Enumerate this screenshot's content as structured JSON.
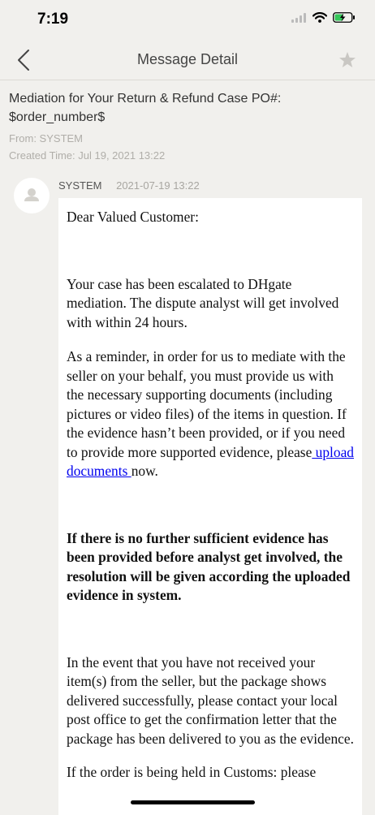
{
  "status_bar": {
    "time": "7:19"
  },
  "nav": {
    "title": "Message Detail"
  },
  "message": {
    "title": "Mediation for Your Return & Refund Case PO#: $order_number$",
    "from": "From: SYSTEM",
    "created": "Created Time: Jul 19, 2021 13:22",
    "sender": "SYSTEM",
    "sent_time": "2021-07-19 13:22",
    "body": {
      "greeting": "Dear Valued Customer:",
      "p1": "Your case has been escalated to DHgate mediation. The dispute analyst will get involved with within 24 hours.",
      "p2_before": "As a reminder, in order for us to mediate with the seller on your behalf, you must provide us with the necessary supporting documents (including pictures or video files) of the items in question. If the evidence hasn’t been provided, or if you need to provide more supported evidence, please",
      "p2_link": " upload documents ",
      "p2_after": "now.",
      "p3": "If there is no further sufficient evidence has been provided before analyst get involved, the resolution will be given according the uploaded evidence in system.",
      "p4": "In the event that you have not received your item(s) from the seller, but the package shows delivered successfully, please contact your local post office to get the confirmation letter that the package has been delivered to you as the evidence.",
      "p5": "If the order is being held in Customs: please"
    }
  },
  "colors": {
    "background": "#f1f0ed",
    "bubble": "#ffffff",
    "link": "#0000ee",
    "battery": "#34c759"
  }
}
